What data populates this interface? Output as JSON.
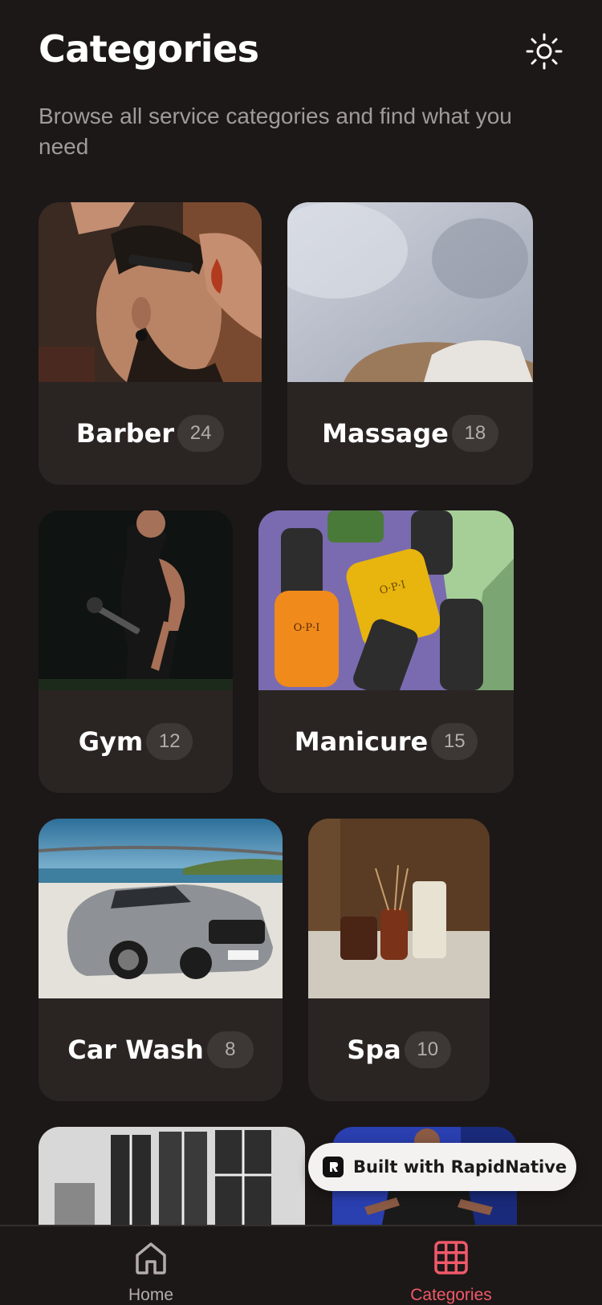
{
  "header": {
    "title": "Categories",
    "subtitle": "Browse all service categories and find what you need",
    "theme_icon": "sun-icon"
  },
  "categories": [
    {
      "name": "Barber",
      "count": "24"
    },
    {
      "name": "Massage",
      "count": "18"
    },
    {
      "name": "Gym",
      "count": "12"
    },
    {
      "name": "Manicure",
      "count": "15"
    },
    {
      "name": "Car Wash",
      "count": "8"
    },
    {
      "name": "Spa",
      "count": "10"
    }
  ],
  "badge": {
    "label": "Built with RapidNative"
  },
  "tabs": [
    {
      "label": "Home",
      "icon": "home-icon",
      "active": false
    },
    {
      "label": "Categories",
      "icon": "grid-icon",
      "active": true
    }
  ],
  "colors": {
    "background": "#1c1817",
    "card": "#2a2523",
    "accent": "#f0596a",
    "muted_text": "#a19b98"
  }
}
